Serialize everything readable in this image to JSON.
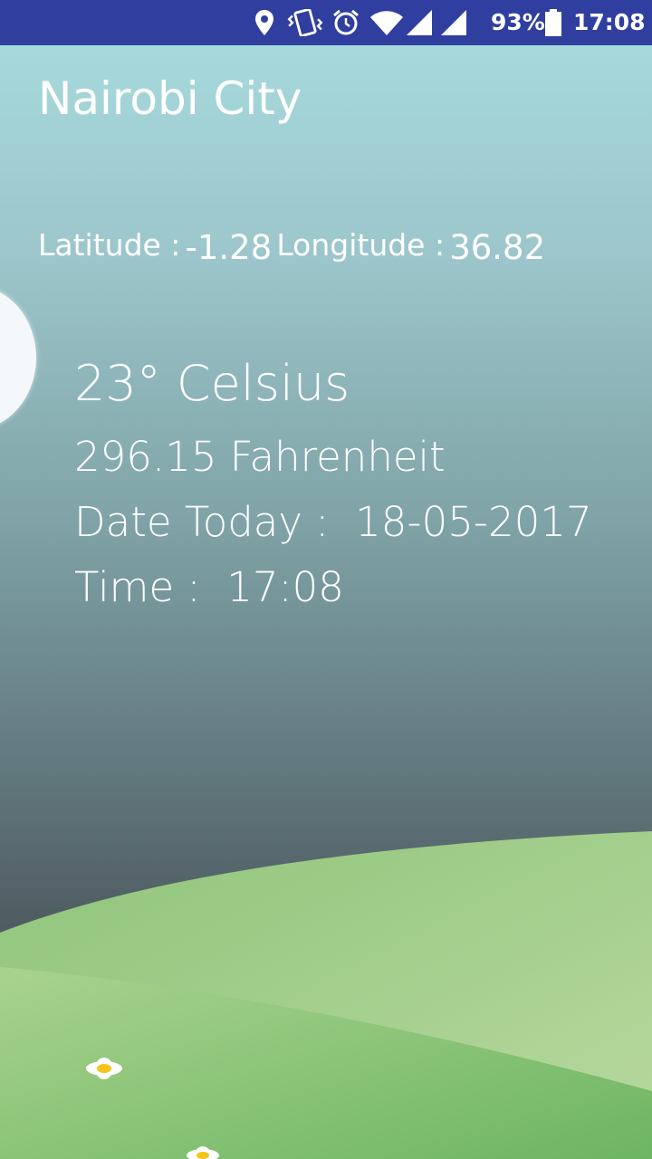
{
  "status_bar": {
    "battery_percent": "93%",
    "time": "17:08",
    "icons": [
      "location-icon",
      "vibrate-icon",
      "alarm-icon",
      "wifi-icon",
      "signal-icon",
      "signal-icon-2",
      "battery-icon"
    ],
    "background_color": "#303f9f"
  },
  "city": {
    "name": "Nairobi City"
  },
  "coordinates": {
    "latitude_label": "Latitude :",
    "latitude_value": "-1.28",
    "longitude_label": "Longitude :",
    "longitude_value": "36.82"
  },
  "weather": {
    "celsius": "23° Celsius",
    "fahrenheit": "296.15 Fahrenheit",
    "date_label": "Date Today :",
    "date_value": "18-05-2017",
    "time_label": "Time :",
    "time_value": "17:08"
  },
  "colors": {
    "sky_top": "#a8dde0",
    "sky_bottom": "#4a565c",
    "grass_light": "#b5d89d",
    "grass_dark": "#6fb662"
  }
}
